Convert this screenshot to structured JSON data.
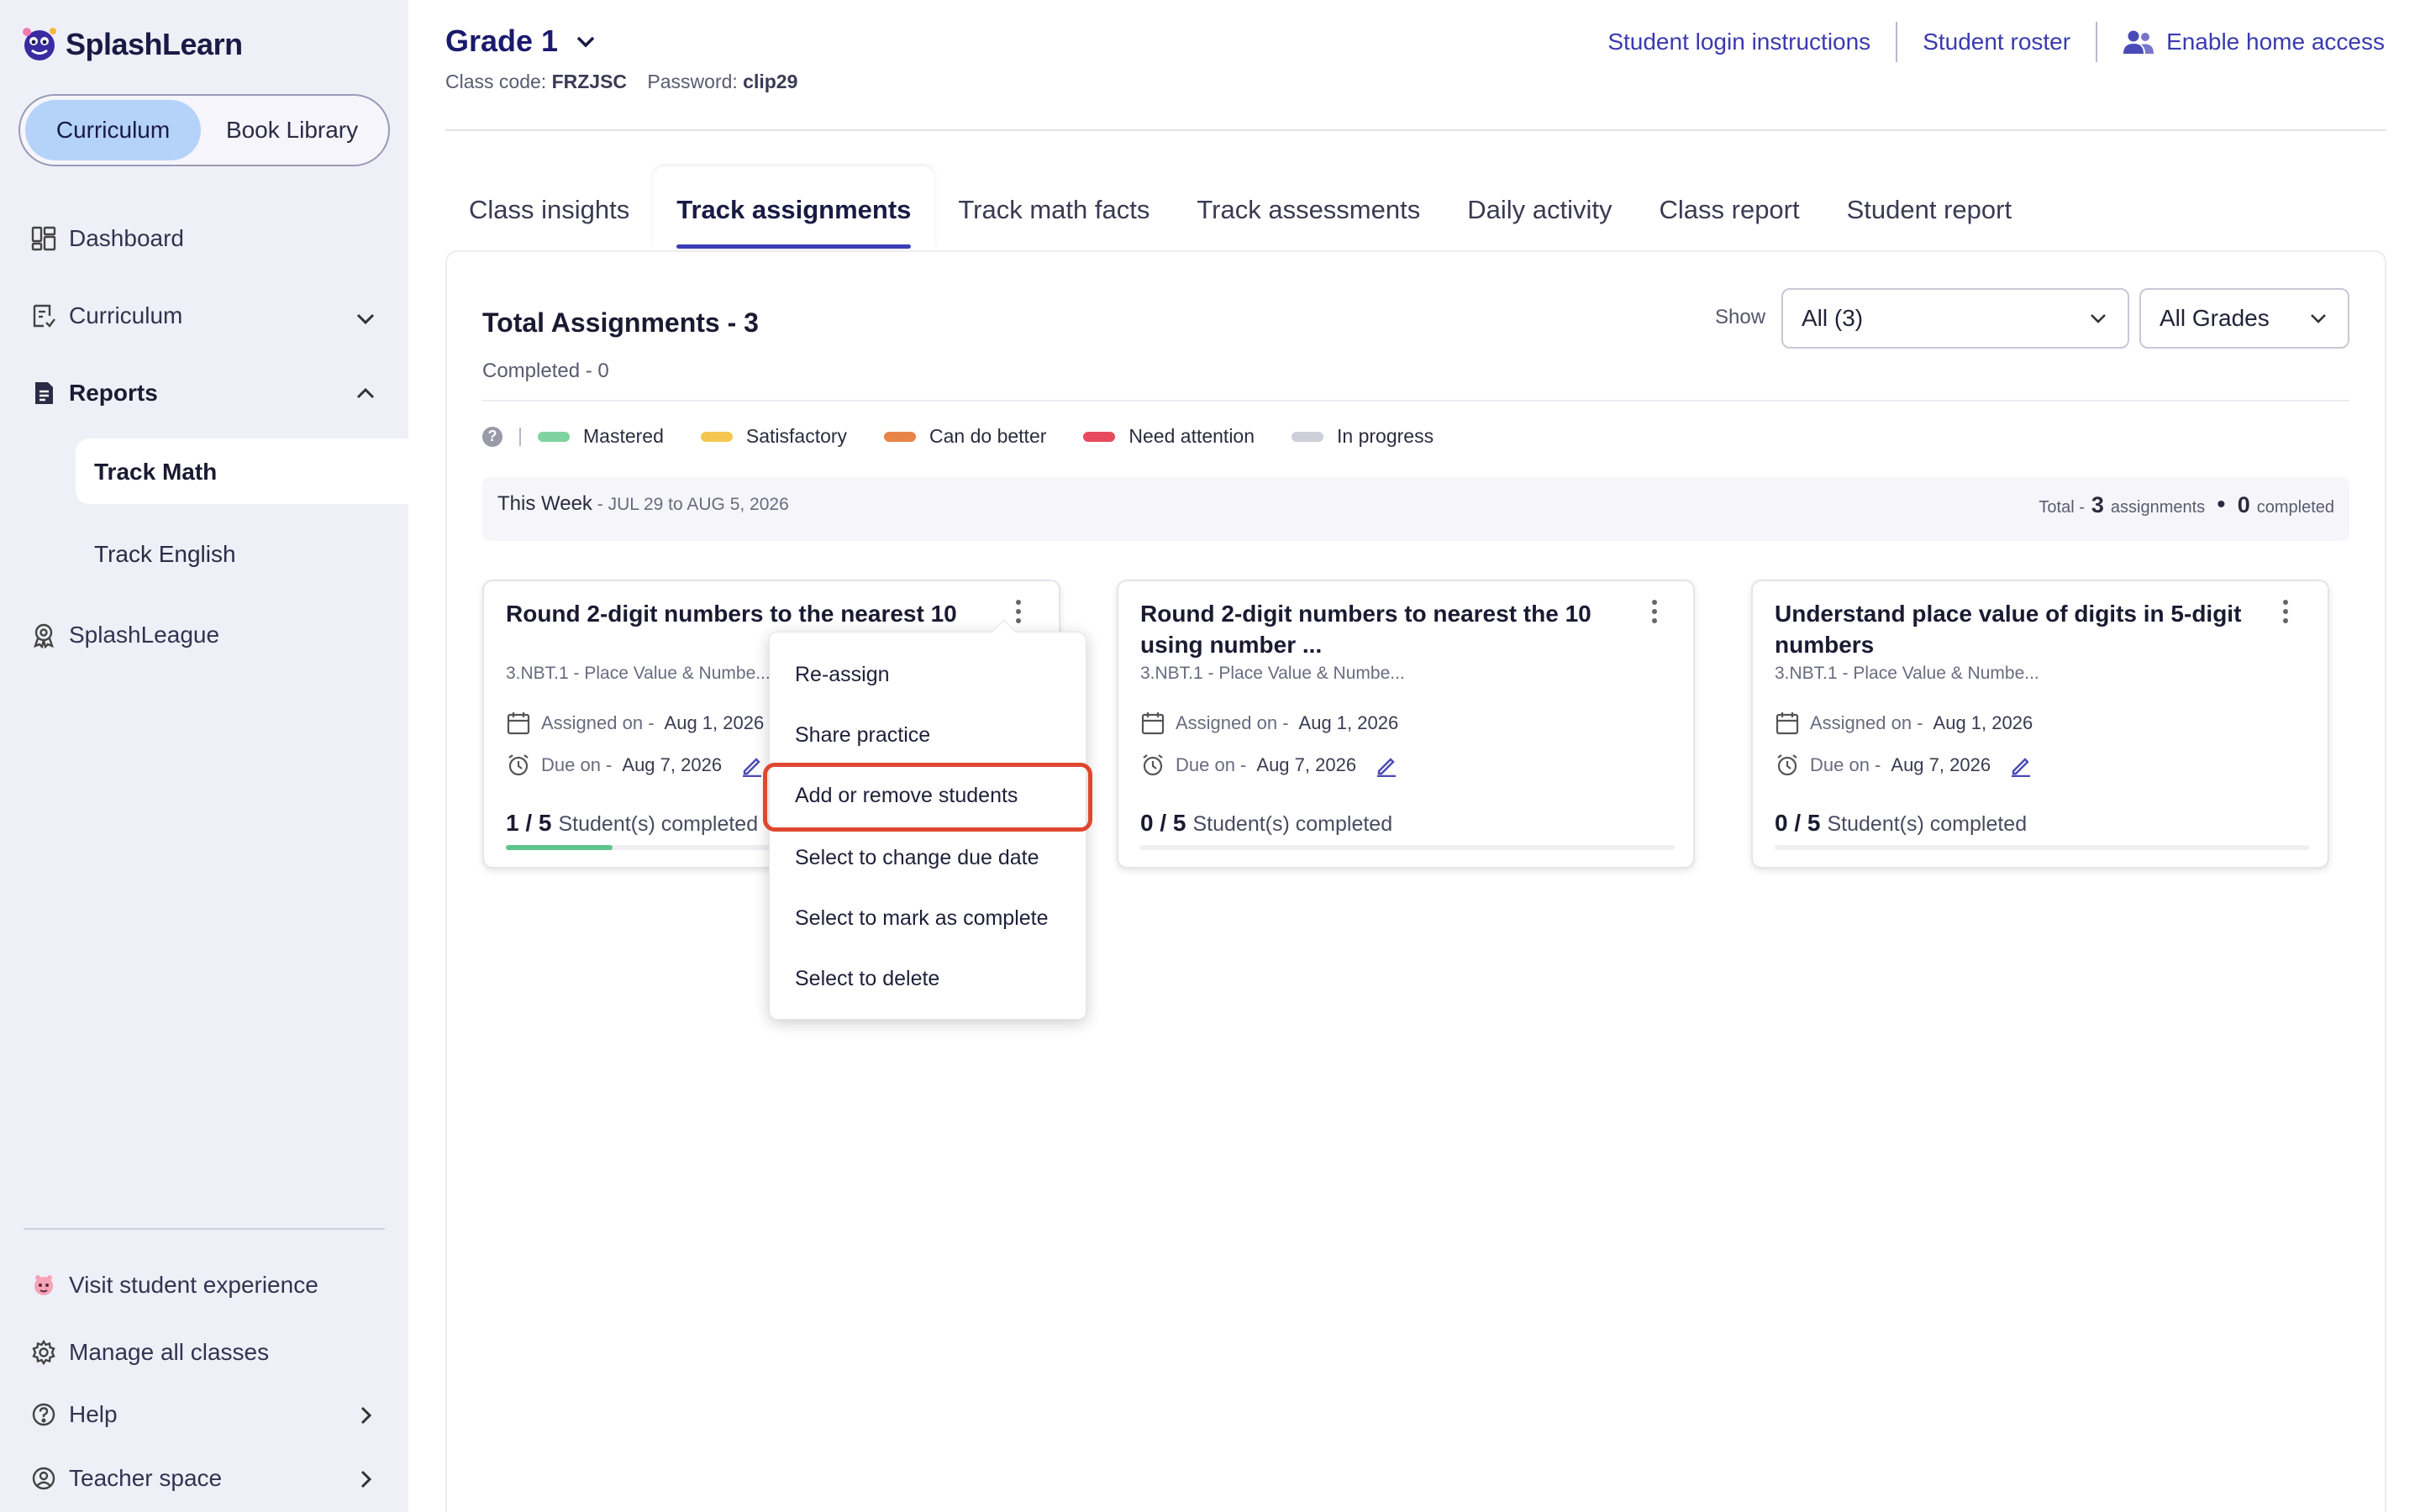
{
  "brand": {
    "name": "SplashLearn"
  },
  "segmented": {
    "curriculum": "Curriculum",
    "book_library": "Book Library"
  },
  "sidebar": {
    "dashboard": "Dashboard",
    "curriculum": "Curriculum",
    "reports": "Reports",
    "track_math": "Track Math",
    "track_english": "Track English",
    "splashleague": "SplashLeague",
    "visit_student": "Visit student experience",
    "manage_classes": "Manage all classes",
    "help": "Help",
    "teacher_space": "Teacher space"
  },
  "header": {
    "grade": "Grade 1",
    "class_code_label": "Class code:",
    "class_code": "FRZJSC",
    "password_label": "Password:",
    "password": "clip29",
    "login_instructions": "Student login instructions",
    "roster": "Student roster",
    "home_access": "Enable home access"
  },
  "tabs": [
    "Class insights",
    "Track assignments",
    "Track math facts",
    "Track assessments",
    "Daily activity",
    "Class report",
    "Student report"
  ],
  "summary": {
    "total": "Total Assignments - 3",
    "completed": "Completed - 0",
    "show_label": "Show",
    "filter_value": "All (3)",
    "grade_filter": "All Grades"
  },
  "legend": {
    "help": "?",
    "items": [
      {
        "label": "Mastered",
        "color": "#7fd39e"
      },
      {
        "label": "Satisfactory",
        "color": "#f5c64f"
      },
      {
        "label": "Can do better",
        "color": "#e98448"
      },
      {
        "label": "Need attention",
        "color": "#e8495c"
      },
      {
        "label": "In progress",
        "color": "#cfcfda"
      }
    ]
  },
  "week": {
    "label": "This Week",
    "dates": " - JUL 29 to AUG 5, 2026",
    "total_prefix": "Total -",
    "total_num": "3",
    "total_suffix": "assignments",
    "completed_num": "0",
    "completed_suffix": "completed"
  },
  "cards": [
    {
      "title": "Round 2-digit numbers to the nearest 10",
      "standard": "3.NBT.1 - Place Value & Numbe...",
      "assigned_label": "Assigned on -",
      "assigned": "Aug 1, 2026",
      "due_label": "Due on -",
      "due": "Aug 7, 2026",
      "completed": "1 / 5",
      "completed_label": "Student(s) completed",
      "progress": 0.2
    },
    {
      "title": "Round 2-digit numbers to nearest the 10 using number ...",
      "standard": "3.NBT.1 - Place Value & Numbe...",
      "assigned_label": "Assigned on -",
      "assigned": "Aug 1, 2026",
      "due_label": "Due on -",
      "due": "Aug 7, 2026",
      "completed": "0 / 5",
      "completed_label": "Student(s) completed",
      "progress": 0
    },
    {
      "title": "Understand place value of digits in 5-digit numbers",
      "standard": "3.NBT.1 - Place Value & Numbe...",
      "assigned_label": "Assigned on -",
      "assigned": "Aug 1, 2026",
      "due_label": "Due on -",
      "due": "Aug 7, 2026",
      "completed": "0 / 5",
      "completed_label": "Student(s) completed",
      "progress": 0
    }
  ],
  "menu": {
    "items": [
      "Re-assign",
      "Share practice",
      "Add or remove students",
      "Select to change due date",
      "Select to mark as complete",
      "Select to delete"
    ],
    "highlight_color": "#e0472f"
  }
}
